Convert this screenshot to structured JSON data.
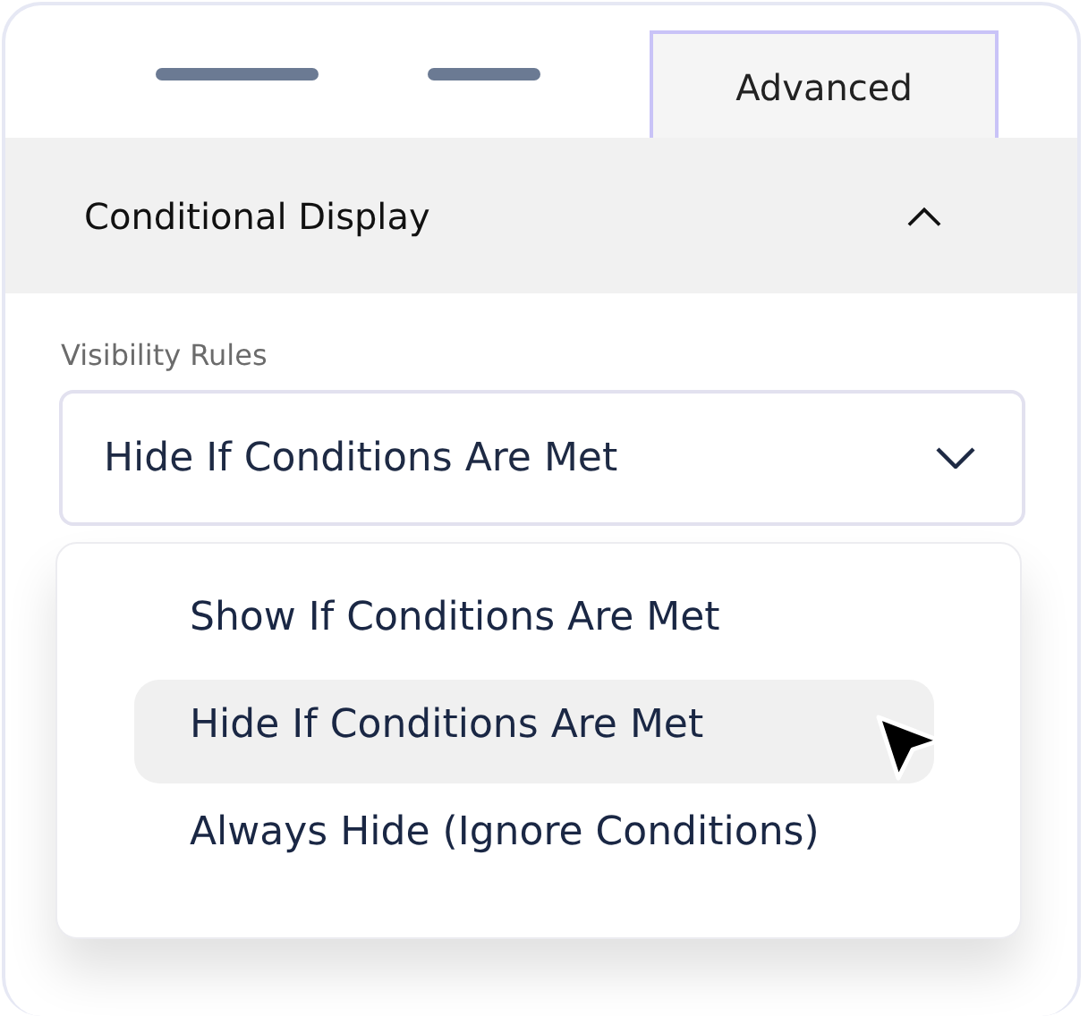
{
  "tabs": [
    {
      "kind": "bar",
      "selected": false
    },
    {
      "kind": "bar",
      "selected": false
    },
    {
      "kind": "text",
      "label": "Advanced",
      "selected": true
    }
  ],
  "section": {
    "title": "Conditional Display",
    "expanded": true,
    "field": {
      "label": "Visibility Rules",
      "value": "Hide If Conditions Are Met",
      "open": true,
      "options": [
        {
          "label": "Show If Conditions Are Met",
          "highlighted": false
        },
        {
          "label": "Hide If Conditions Are Met",
          "highlighted": true
        },
        {
          "label": "Always Hide (Ignore Conditions)",
          "highlighted": false
        }
      ]
    }
  }
}
